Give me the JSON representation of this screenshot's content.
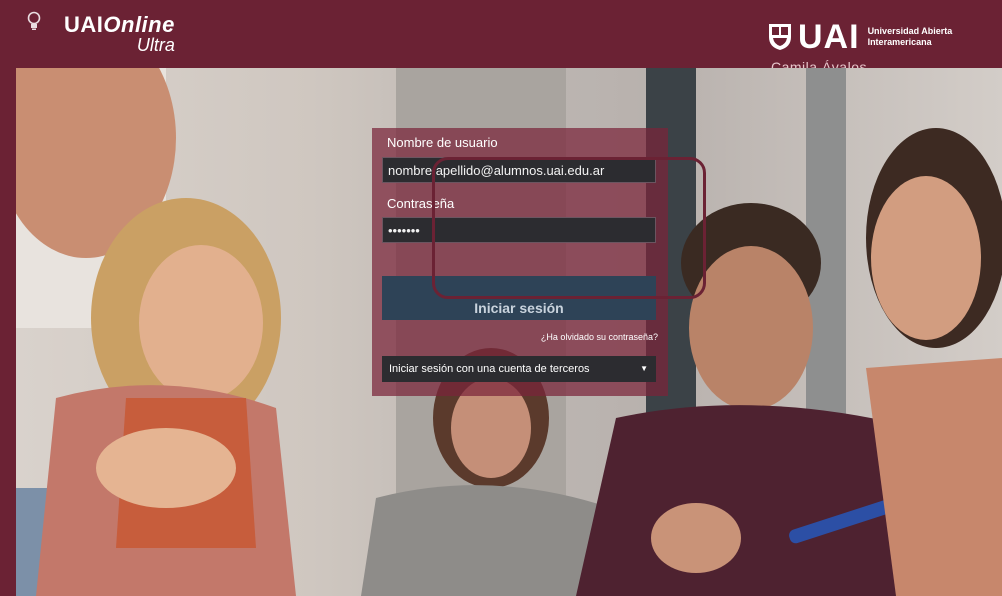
{
  "header": {
    "brand_line1_a": "UAI",
    "brand_line1_b": "Online",
    "brand_line2": "Ultra",
    "logo_icon": "bulb-icon",
    "uai_text": "UAI",
    "uai_sub_1": "Universidad Abierta",
    "uai_sub_2": "Interamericana",
    "user_name": "Camila Ávalos"
  },
  "login": {
    "username_label": "Nombre de usuario",
    "username_value": "nombre.apellido@alumnos.uai.edu.ar",
    "password_label": "Contraseña",
    "password_value": "•••••••",
    "submit_label": "Iniciar sesión",
    "forgot_label": "¿Ha olvidado su contraseña?",
    "third_party_label": "Iniciar sesión con una cuenta de terceros",
    "third_party_caret": "▼"
  },
  "colors": {
    "brand": "#6b2234",
    "button": "#2e4357",
    "field": "#2c2c30"
  }
}
